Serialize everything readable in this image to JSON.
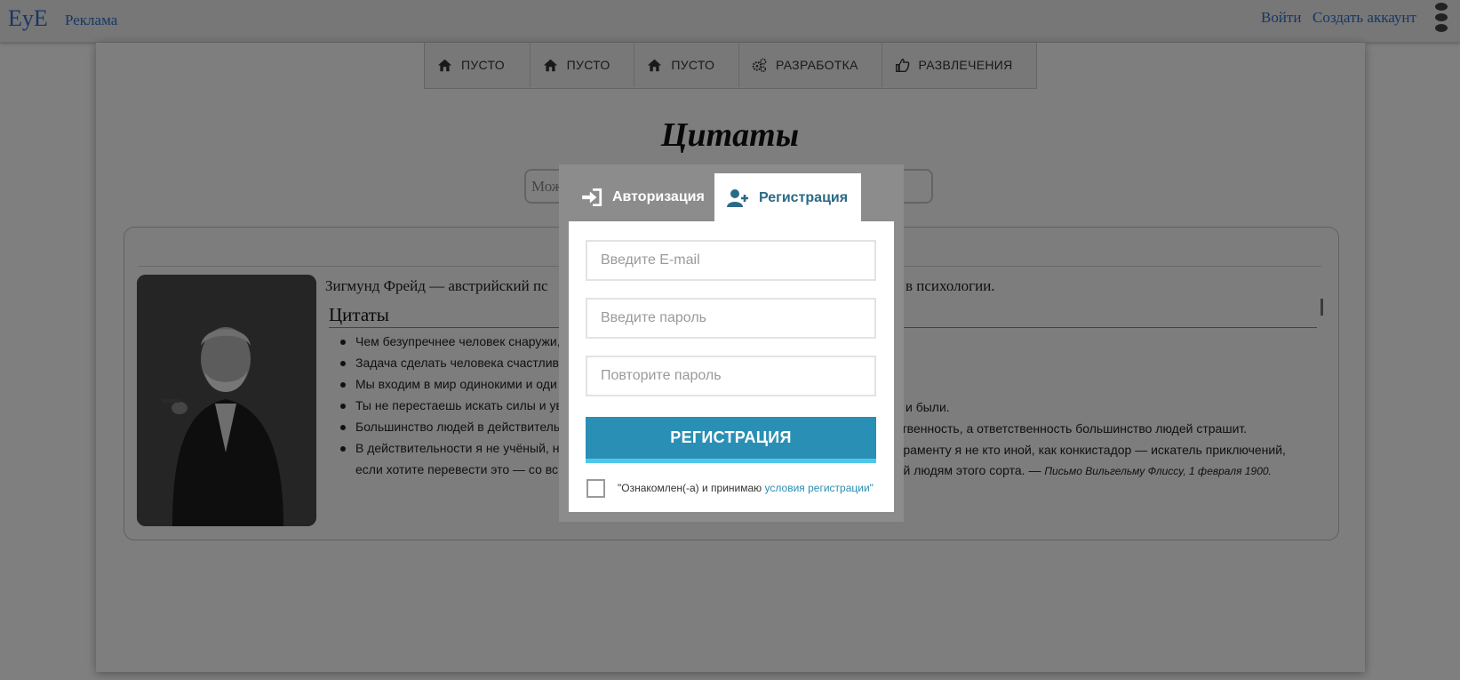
{
  "topbar": {
    "logo": "EyE",
    "ads": "Реклама",
    "login": "Войти",
    "signup": "Создать аккаунт"
  },
  "nav": [
    {
      "label": "ПУСТО",
      "icon": "home-icon"
    },
    {
      "label": "ПУСТО",
      "icon": "home-icon"
    },
    {
      "label": "ПУСТО",
      "icon": "home-icon"
    },
    {
      "label": "РАЗРАБОТКА",
      "icon": "gears-icon"
    },
    {
      "label": "РАЗВЛЕЧЕНИЯ",
      "icon": "thumbs-up-icon"
    }
  ],
  "page": {
    "title": "Цитаты",
    "search_placeholder": "Мож"
  },
  "article": {
    "bio_start": "Зигмунд Фрейд — австрийский пс",
    "bio_end": "в психологии.",
    "section_title": "Цитаты",
    "quotes": [
      {
        "left": "Чем безупречнее человек снаружи,",
        "right": ""
      },
      {
        "left": "Задача сделать человека счастлив",
        "right": ""
      },
      {
        "left": "Мы входим в мир одинокими и оди",
        "right": ""
      },
      {
        "left": "Ты не перестаешь искать силы и ув",
        "right": "и были."
      },
      {
        "left": "Большинство людей в действитель",
        "right": "тственность, а ответственность большинство людей страшит."
      },
      {
        "left": "В действительности я не учёный, н",
        "right": "пераменту я не кто иной, как конкистадор — искатель приключений,"
      },
      {
        "left": "если хотите перевести это — со вс",
        "right": "ной людям этого сорта. —",
        "source": "Письмо Вильгельму Флиссу, 1 февраля 1900."
      }
    ]
  },
  "modal": {
    "tab_login": "Авторизация",
    "tab_register": "Регистрация",
    "email_placeholder": "Введите E-mail",
    "password_placeholder": "Введите пароль",
    "repeat_placeholder": "Повторите пароль",
    "submit": "РЕГИСТРАЦИЯ",
    "agree_text": "\"Ознакомлен(-а) и принимаю ",
    "agree_link": "условия регистрации\""
  },
  "colors": {
    "link": "#2f6fc9",
    "accent": "#2a8fb4",
    "accent_light": "#4ec8ea",
    "tab_text": "#2a6a86"
  }
}
